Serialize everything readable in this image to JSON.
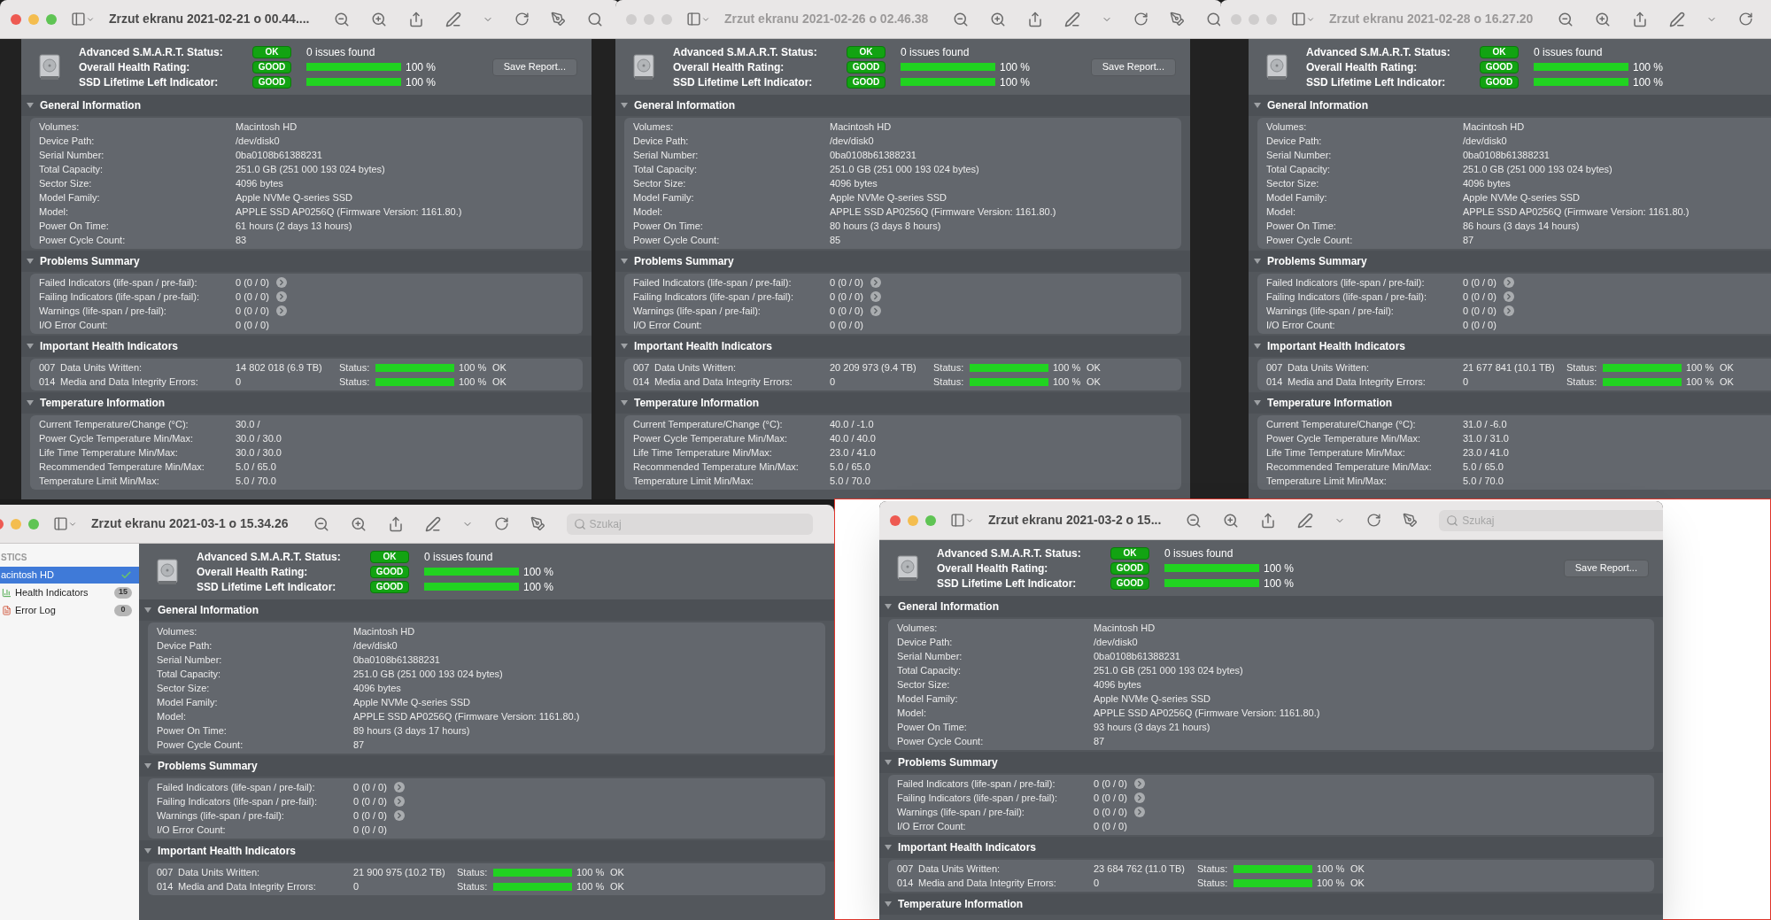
{
  "windows": [
    {
      "title": "Zrzut ekranu 2021-02-21 o 00.44....",
      "active": true,
      "save_button": "Save Report...",
      "summary": [
        {
          "kind": "text",
          "label": "Advanced S.M.A.R.T. Status:",
          "badge": "OK",
          "text": "0 issues found"
        },
        {
          "kind": "meter",
          "label": "Overall Health Rating:",
          "badge": "GOOD",
          "level": 1,
          "reading": "100 %"
        },
        {
          "kind": "meter",
          "label": "SSD Lifetime Left Indicator:",
          "badge": "GOOD",
          "level": 1,
          "reading": "100 %"
        }
      ],
      "sections": [
        {
          "title": "General Information",
          "expanded": true,
          "rows": [
            {
              "kind": "info",
              "label": "Volumes:",
              "value": "Macintosh HD"
            },
            {
              "kind": "info",
              "label": "Device Path:",
              "value": "/dev/disk0"
            },
            {
              "kind": "info",
              "label": "Serial Number:",
              "value": "0ba0108b61388231"
            },
            {
              "kind": "info",
              "label": "Total Capacity:",
              "value": "251.0 GB (251 000 193 024 bytes)"
            },
            {
              "kind": "info",
              "label": "Sector Size:",
              "value": "4096 bytes"
            },
            {
              "kind": "info",
              "label": "Model Family:",
              "value": "Apple NVMe Q-series SSD"
            },
            {
              "kind": "info",
              "label": "Model:",
              "value": "APPLE SSD AP0256Q  (Firmware Version: 1161.80.)"
            },
            {
              "kind": "info",
              "label": "Power On Time:",
              "value": "61 hours (2 days 13 hours)"
            },
            {
              "kind": "info",
              "label": "Power Cycle Count:",
              "value": "83"
            }
          ]
        },
        {
          "title": "Problems Summary",
          "expanded": true,
          "rows": [
            {
              "kind": "link",
              "label": "Failed Indicators (life-span / pre-fail):",
              "value": "0 (0 / 0)"
            },
            {
              "kind": "link",
              "label": "Failing Indicators (life-span / pre-fail):",
              "value": "0 (0 / 0)"
            },
            {
              "kind": "link",
              "label": "Warnings (life-span / pre-fail):",
              "value": "0 (0 / 0)"
            },
            {
              "kind": "info",
              "label": "I/O Error Count:",
              "value": "0 (0 / 0)"
            }
          ]
        },
        {
          "title": "Important Health Indicators",
          "expanded": true,
          "rows": [
            {
              "kind": "indicator",
              "id": "007",
              "label": "Data Units Written:",
              "value": "14 802 018 (6.9 TB)",
              "status_label": "Status:",
              "level": 1,
              "reading": "100 %",
              "result": "OK"
            },
            {
              "kind": "indicator",
              "id": "014",
              "label": "Media and Data Integrity Errors:",
              "value": "0",
              "status_label": "Status:",
              "level": 1,
              "reading": "100 %",
              "result": "OK"
            }
          ]
        },
        {
          "title": "Temperature Information",
          "expanded": true,
          "rows": [
            {
              "kind": "info",
              "label": "Current Temperature/Change (°C):",
              "value": "30.0 /"
            },
            {
              "kind": "info",
              "label": "Power Cycle Temperature Min/Max:",
              "value": "30.0 / 30.0"
            },
            {
              "kind": "info",
              "label": "Life Time Temperature Min/Max:",
              "value": "30.0 / 30.0"
            },
            {
              "kind": "info",
              "label": "Recommended Temperature Min/Max:",
              "value": "5.0   / 65.0"
            },
            {
              "kind": "info",
              "label": "Temperature Limit Min/Max:",
              "value": "5.0   / 70.0"
            }
          ]
        }
      ]
    },
    {
      "title": "Zrzut ekranu 2021-02-26 o 02.46.38",
      "active": false,
      "save_button": "Save Report...",
      "summary": [
        {
          "kind": "text",
          "label": "Advanced S.M.A.R.T. Status:",
          "badge": "OK",
          "text": "0 issues found"
        },
        {
          "kind": "meter",
          "label": "Overall Health Rating:",
          "badge": "GOOD",
          "level": 1,
          "reading": "100 %"
        },
        {
          "kind": "meter",
          "label": "SSD Lifetime Left Indicator:",
          "badge": "GOOD",
          "level": 1,
          "reading": "100 %"
        }
      ],
      "sections": [
        {
          "title": "General Information",
          "expanded": true,
          "rows": [
            {
              "kind": "info",
              "label": "Volumes:",
              "value": "Macintosh HD"
            },
            {
              "kind": "info",
              "label": "Device Path:",
              "value": "/dev/disk0"
            },
            {
              "kind": "info",
              "label": "Serial Number:",
              "value": "0ba0108b61388231"
            },
            {
              "kind": "info",
              "label": "Total Capacity:",
              "value": "251.0 GB (251 000 193 024 bytes)"
            },
            {
              "kind": "info",
              "label": "Sector Size:",
              "value": "4096 bytes"
            },
            {
              "kind": "info",
              "label": "Model Family:",
              "value": "Apple NVMe Q-series SSD"
            },
            {
              "kind": "info",
              "label": "Model:",
              "value": "APPLE SSD AP0256Q  (Firmware Version: 1161.80.)"
            },
            {
              "kind": "info",
              "label": "Power On Time:",
              "value": "80 hours (3 days 8 hours)"
            },
            {
              "kind": "info",
              "label": "Power Cycle Count:",
              "value": "85"
            }
          ]
        },
        {
          "title": "Problems Summary",
          "expanded": true,
          "rows": [
            {
              "kind": "link",
              "label": "Failed Indicators (life-span / pre-fail):",
              "value": "0 (0 / 0)"
            },
            {
              "kind": "link",
              "label": "Failing Indicators (life-span / pre-fail):",
              "value": "0 (0 / 0)"
            },
            {
              "kind": "link",
              "label": "Warnings (life-span / pre-fail):",
              "value": "0 (0 / 0)"
            },
            {
              "kind": "info",
              "label": "I/O Error Count:",
              "value": "0 (0 / 0)"
            }
          ]
        },
        {
          "title": "Important Health Indicators",
          "expanded": true,
          "rows": [
            {
              "kind": "indicator",
              "id": "007",
              "label": "Data Units Written:",
              "value": "20 209 973 (9.4 TB)",
              "status_label": "Status:",
              "level": 1,
              "reading": "100 %",
              "result": "OK"
            },
            {
              "kind": "indicator",
              "id": "014",
              "label": "Media and Data Integrity Errors:",
              "value": "0",
              "status_label": "Status:",
              "level": 1,
              "reading": "100 %",
              "result": "OK"
            }
          ]
        },
        {
          "title": "Temperature Information",
          "expanded": true,
          "rows": [
            {
              "kind": "info",
              "label": "Current Temperature/Change (°C):",
              "value": "40.0 / -1.0"
            },
            {
              "kind": "info",
              "label": "Power Cycle Temperature Min/Max:",
              "value": "40.0 / 40.0"
            },
            {
              "kind": "info",
              "label": "Life Time Temperature Min/Max:",
              "value": "23.0 / 41.0"
            },
            {
              "kind": "info",
              "label": "Recommended Temperature Min/Max:",
              "value": "5.0   / 65.0"
            },
            {
              "kind": "info",
              "label": "Temperature Limit Min/Max:",
              "value": "5.0   / 70.0"
            }
          ]
        }
      ]
    },
    {
      "title": "Zrzut ekranu 2021-02-28 o 16.27.20",
      "active": false,
      "summary": [
        {
          "kind": "text",
          "label": "Advanced S.M.A.R.T. Status:",
          "badge": "OK",
          "text": "0 issues found"
        },
        {
          "kind": "meter",
          "label": "Overall Health Rating:",
          "badge": "GOOD",
          "level": 1,
          "reading": "100 %"
        },
        {
          "kind": "meter",
          "label": "SSD Lifetime Left Indicator:",
          "badge": "GOOD",
          "level": 1,
          "reading": "100 %"
        }
      ],
      "sections": [
        {
          "title": "General Information",
          "expanded": true,
          "rows": [
            {
              "kind": "info",
              "label": "Volumes:",
              "value": "Macintosh HD"
            },
            {
              "kind": "info",
              "label": "Device Path:",
              "value": "/dev/disk0"
            },
            {
              "kind": "info",
              "label": "Serial Number:",
              "value": "0ba0108b61388231"
            },
            {
              "kind": "info",
              "label": "Total Capacity:",
              "value": "251.0 GB (251 000 193 024 bytes)"
            },
            {
              "kind": "info",
              "label": "Sector Size:",
              "value": "4096 bytes"
            },
            {
              "kind": "info",
              "label": "Model Family:",
              "value": "Apple NVMe Q-series SSD"
            },
            {
              "kind": "info",
              "label": "Model:",
              "value": "APPLE SSD AP0256Q  (Firmware Version: 1161.80.)"
            },
            {
              "kind": "info",
              "label": "Power On Time:",
              "value": "86 hours (3 days 14 hours)"
            },
            {
              "kind": "info",
              "label": "Power Cycle Count:",
              "value": "87"
            }
          ]
        },
        {
          "title": "Problems Summary",
          "expanded": true,
          "rows": [
            {
              "kind": "link",
              "label": "Failed Indicators (life-span / pre-fail):",
              "value": "0 (0 / 0)"
            },
            {
              "kind": "link",
              "label": "Failing Indicators (life-span / pre-fail):",
              "value": "0 (0 / 0)"
            },
            {
              "kind": "link",
              "label": "Warnings (life-span / pre-fail):",
              "value": "0 (0 / 0)"
            },
            {
              "kind": "info",
              "label": "I/O Error Count:",
              "value": "0 (0 / 0)"
            }
          ]
        },
        {
          "title": "Important Health Indicators",
          "expanded": true,
          "rows": [
            {
              "kind": "indicator",
              "id": "007",
              "label": "Data Units Written:",
              "value": "21 677 841 (10.1 TB)",
              "status_label": "Status:",
              "level": 1,
              "reading": "100 %",
              "result": "OK"
            },
            {
              "kind": "indicator",
              "id": "014",
              "label": "Media and Data Integrity Errors:",
              "value": "0",
              "status_label": "Status:",
              "level": 1,
              "reading": "100 %",
              "result": "OK"
            }
          ]
        },
        {
          "title": "Temperature Information",
          "expanded": true,
          "rows": [
            {
              "kind": "info",
              "label": "Current Temperature/Change (°C):",
              "value": "31.0 / -6.0"
            },
            {
              "kind": "info",
              "label": "Power Cycle Temperature Min/Max:",
              "value": "31.0 / 31.0"
            },
            {
              "kind": "info",
              "label": "Life Time Temperature Min/Max:",
              "value": "23.0 / 41.0"
            },
            {
              "kind": "info",
              "label": "Recommended Temperature Min/Max:",
              "value": "5.0   / 65.0"
            },
            {
              "kind": "info",
              "label": "Temperature Limit Min/Max:",
              "value": "5.0   / 70.0"
            }
          ]
        }
      ]
    },
    {
      "title": "Zrzut ekranu 2021-03-1 o 15.34.26",
      "active": true,
      "search": {
        "placeholder": "Szukaj"
      },
      "sidebar": {
        "heading": "STICS",
        "items": [
          {
            "label": "acintosh HD",
            "selected": true,
            "verified": true,
            "children": [
              {
                "kind": "health",
                "label": "Health Indicators",
                "count": "15",
                "selected": false
              },
              {
                "kind": "log",
                "label": "Error Log",
                "count": "0",
                "selected": false
              }
            ]
          }
        ]
      },
      "summary": [
        {
          "kind": "text",
          "label": "Advanced S.M.A.R.T. Status:",
          "badge": "OK",
          "text": "0 issues found"
        },
        {
          "kind": "meter",
          "label": "Overall Health Rating:",
          "badge": "GOOD",
          "level": 1,
          "reading": "100 %"
        },
        {
          "kind": "meter",
          "label": "SSD Lifetime Left Indicator:",
          "badge": "GOOD",
          "level": 1,
          "reading": "100 %"
        }
      ],
      "sections": [
        {
          "title": "General Information",
          "expanded": true,
          "rows": [
            {
              "kind": "info",
              "label": "Volumes:",
              "value": "Macintosh HD"
            },
            {
              "kind": "info",
              "label": "Device Path:",
              "value": "/dev/disk0"
            },
            {
              "kind": "info",
              "label": "Serial Number:",
              "value": "0ba0108b61388231"
            },
            {
              "kind": "info",
              "label": "Total Capacity:",
              "value": "251.0 GB (251 000 193 024 bytes)"
            },
            {
              "kind": "info",
              "label": "Sector Size:",
              "value": "4096 bytes"
            },
            {
              "kind": "info",
              "label": "Model Family:",
              "value": "Apple NVMe Q-series SSD"
            },
            {
              "kind": "info",
              "label": "Model:",
              "value": "APPLE SSD AP0256Q  (Firmware Version: 1161.80.)"
            },
            {
              "kind": "info",
              "label": "Power On Time:",
              "value": "89 hours (3 days 17 hours)"
            },
            {
              "kind": "info",
              "label": "Power Cycle Count:",
              "value": "87"
            }
          ]
        },
        {
          "title": "Problems Summary",
          "expanded": true,
          "rows": [
            {
              "kind": "link",
              "label": "Failed Indicators (life-span / pre-fail):",
              "value": "0 (0 / 0)"
            },
            {
              "kind": "link",
              "label": "Failing Indicators (life-span / pre-fail):",
              "value": "0 (0 / 0)"
            },
            {
              "kind": "link",
              "label": "Warnings (life-span / pre-fail):",
              "value": "0 (0 / 0)"
            },
            {
              "kind": "info",
              "label": "I/O Error Count:",
              "value": "0 (0 / 0)"
            }
          ]
        },
        {
          "title": "Important Health Indicators",
          "expanded": true,
          "rows": [
            {
              "kind": "indicator",
              "id": "007",
              "label": "Data Units Written:",
              "value": "21 900 975 (10.2 TB)",
              "status_label": "Status:",
              "level": 1,
              "reading": "100 %",
              "result": "OK"
            },
            {
              "kind": "indicator",
              "id": "014",
              "label": "Media and Data Integrity Errors:",
              "value": "0",
              "status_label": "Status:",
              "level": 1,
              "reading": "100 %",
              "result": "OK"
            }
          ]
        }
      ]
    },
    {
      "title": "Zrzut ekranu 2021-03-2 o 15...",
      "active": true,
      "search": {
        "placeholder": "Szukaj"
      },
      "save_button": "Save Report...",
      "summary": [
        {
          "kind": "text",
          "label": "Advanced S.M.A.R.T. Status:",
          "badge": "OK",
          "text": "0 issues found"
        },
        {
          "kind": "meter",
          "label": "Overall Health Rating:",
          "badge": "GOOD",
          "level": 1,
          "reading": "100 %"
        },
        {
          "kind": "meter",
          "label": "SSD Lifetime Left Indicator:",
          "badge": "GOOD",
          "level": 1,
          "reading": "100 %"
        }
      ],
      "sections": [
        {
          "title": "General Information",
          "expanded": true,
          "rows": [
            {
              "kind": "info",
              "label": "Volumes:",
              "value": "Macintosh HD"
            },
            {
              "kind": "info",
              "label": "Device Path:",
              "value": "/dev/disk0"
            },
            {
              "kind": "info",
              "label": "Serial Number:",
              "value": "0ba0108b61388231"
            },
            {
              "kind": "info",
              "label": "Total Capacity:",
              "value": "251.0 GB (251 000 193 024 bytes)"
            },
            {
              "kind": "info",
              "label": "Sector Size:",
              "value": "4096 bytes"
            },
            {
              "kind": "info",
              "label": "Model Family:",
              "value": "Apple NVMe Q-series SSD"
            },
            {
              "kind": "info",
              "label": "Model:",
              "value": "APPLE SSD AP0256Q  (Firmware Version: 1161.80.)"
            },
            {
              "kind": "info",
              "label": "Power On Time:",
              "value": "93 hours (3 days 21 hours)"
            },
            {
              "kind": "info",
              "label": "Power Cycle Count:",
              "value": "87"
            }
          ]
        },
        {
          "title": "Problems Summary",
          "expanded": true,
          "rows": [
            {
              "kind": "link",
              "label": "Failed Indicators (life-span / pre-fail):",
              "value": "0 (0 / 0)"
            },
            {
              "kind": "link",
              "label": "Failing Indicators (life-span / pre-fail):",
              "value": "0 (0 / 0)"
            },
            {
              "kind": "link",
              "label": "Warnings (life-span / pre-fail):",
              "value": "0 (0 / 0)"
            },
            {
              "kind": "info",
              "label": "I/O Error Count:",
              "value": "0 (0 / 0)"
            }
          ]
        },
        {
          "title": "Important Health Indicators",
          "expanded": true,
          "rows": [
            {
              "kind": "indicator",
              "id": "007",
              "label": "Data Units Written:",
              "value": "23 684 762 (11.0 TB)",
              "status_label": "Status:",
              "level": 1,
              "reading": "100 %",
              "result": "OK"
            },
            {
              "kind": "indicator",
              "id": "014",
              "label": "Media and Data Integrity Errors:",
              "value": "0",
              "status_label": "Status:",
              "level": 1,
              "reading": "100 %",
              "result": "OK"
            }
          ]
        },
        {
          "title": "Temperature Information",
          "expanded": true
        }
      ]
    }
  ]
}
